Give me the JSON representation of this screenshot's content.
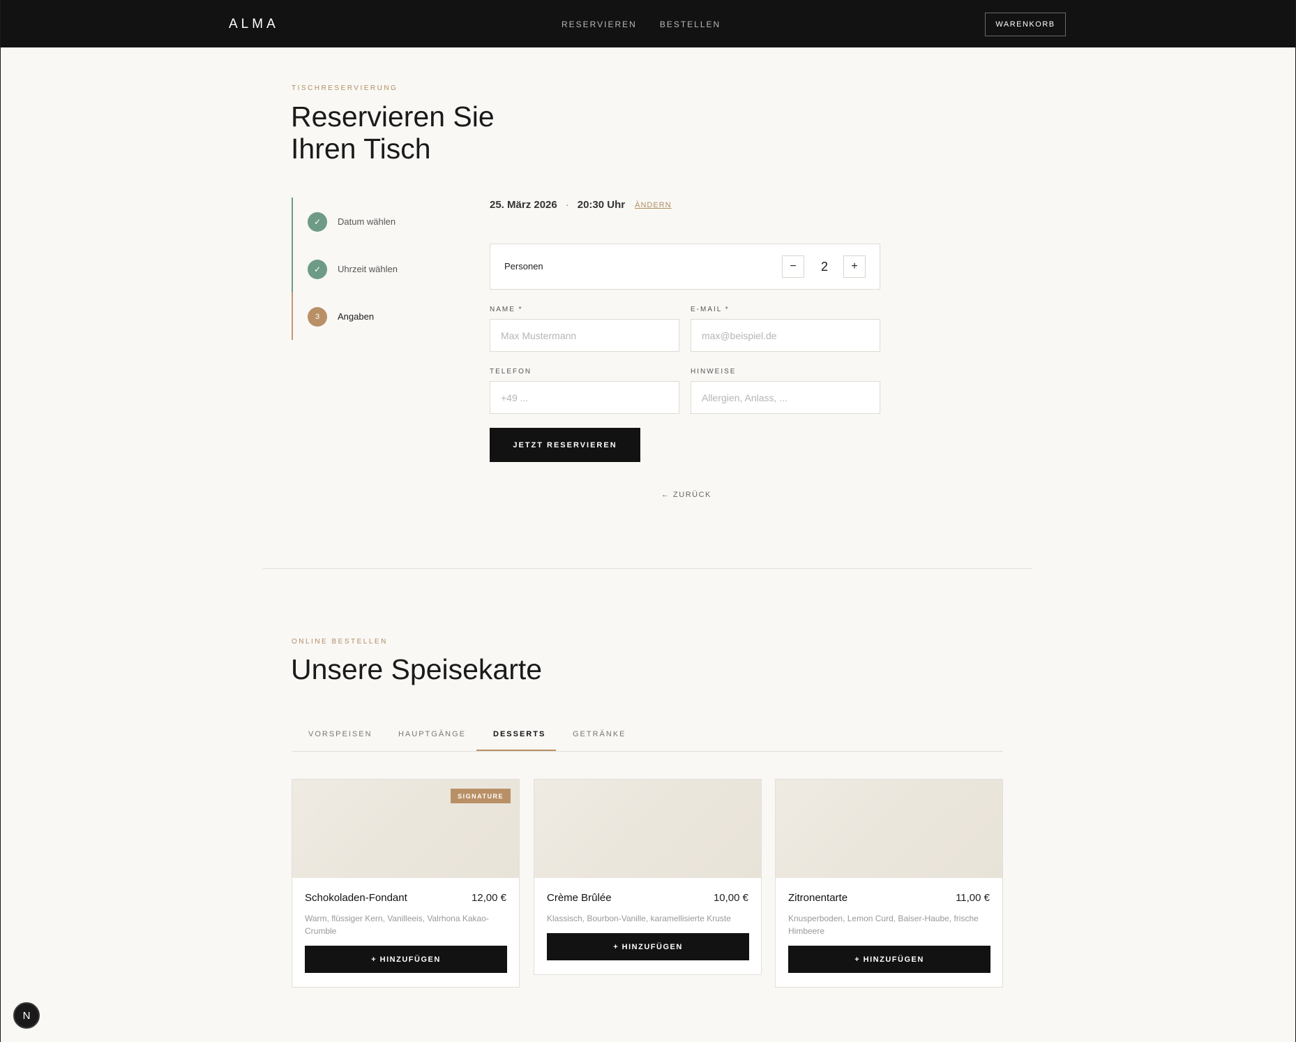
{
  "nav": {
    "logo": "ALMA",
    "links": [
      "RESERVIEREN",
      "BESTELLEN"
    ],
    "cart_label": "WARENKORB"
  },
  "reservation": {
    "eyebrow": "TISCHRESERVIERUNG",
    "title_line1": "Reservieren Sie",
    "title_line2": "Ihren Tisch",
    "steps": [
      {
        "label": "Datum wählen",
        "status": "done",
        "marker": "✓"
      },
      {
        "label": "Uhrzeit wählen",
        "status": "done",
        "marker": "✓"
      },
      {
        "label": "Angaben",
        "status": "active",
        "marker": "3"
      }
    ],
    "summary": {
      "date": "25. März 2026",
      "separator": "·",
      "time": "20:30 Uhr",
      "change_label": "ÄNDERN"
    },
    "persons": {
      "label": "Personen",
      "value": "2",
      "minus": "−",
      "plus": "+"
    },
    "fields": {
      "name": {
        "label": "NAME *",
        "placeholder": "Max Mustermann",
        "value": ""
      },
      "email": {
        "label": "E-MAIL *",
        "placeholder": "max@beispiel.de",
        "value": ""
      },
      "phone": {
        "label": "TELEFON",
        "placeholder": "+49 ...",
        "value": ""
      },
      "notes": {
        "label": "HINWEISE",
        "placeholder": "Allergien, Anlass, ...",
        "value": ""
      }
    },
    "submit_label": "JETZT RESERVIEREN",
    "back_label": "← ZURÜCK"
  },
  "menu": {
    "eyebrow": "ONLINE BESTELLEN",
    "title": "Unsere Speisekarte",
    "tabs": [
      {
        "label": "VORSPEISEN",
        "active": false
      },
      {
        "label": "HAUPTGÄNGE",
        "active": false
      },
      {
        "label": "DESSERTS",
        "active": true
      },
      {
        "label": "GETRÄNKE",
        "active": false
      }
    ],
    "items": [
      {
        "name": "Schokoladen-Fondant",
        "price": "12,00 €",
        "description": "Warm, flüssiger Kern, Vanilleeis, Valrhona Kakao-Crumble",
        "badge": "SIGNATURE",
        "add_label": "+ HINZUFÜGEN"
      },
      {
        "name": "Crème Brûlée",
        "price": "10,00 €",
        "description": "Klassisch, Bourbon-Vanille, karamellisierte Kruste",
        "badge": "",
        "add_label": "+ HINZUFÜGEN"
      },
      {
        "name": "Zitronentarte",
        "price": "11,00 €",
        "description": "Knusperboden, Lemon Curd, Baiser-Haube, frische Himbeere",
        "badge": "",
        "add_label": "+ HINZUFÜGEN"
      }
    ]
  },
  "dev_badge": "N",
  "colors": {
    "accent": "#b99066",
    "success": "#6e9b86",
    "dark": "#121212",
    "background": "#f9f8f5"
  }
}
